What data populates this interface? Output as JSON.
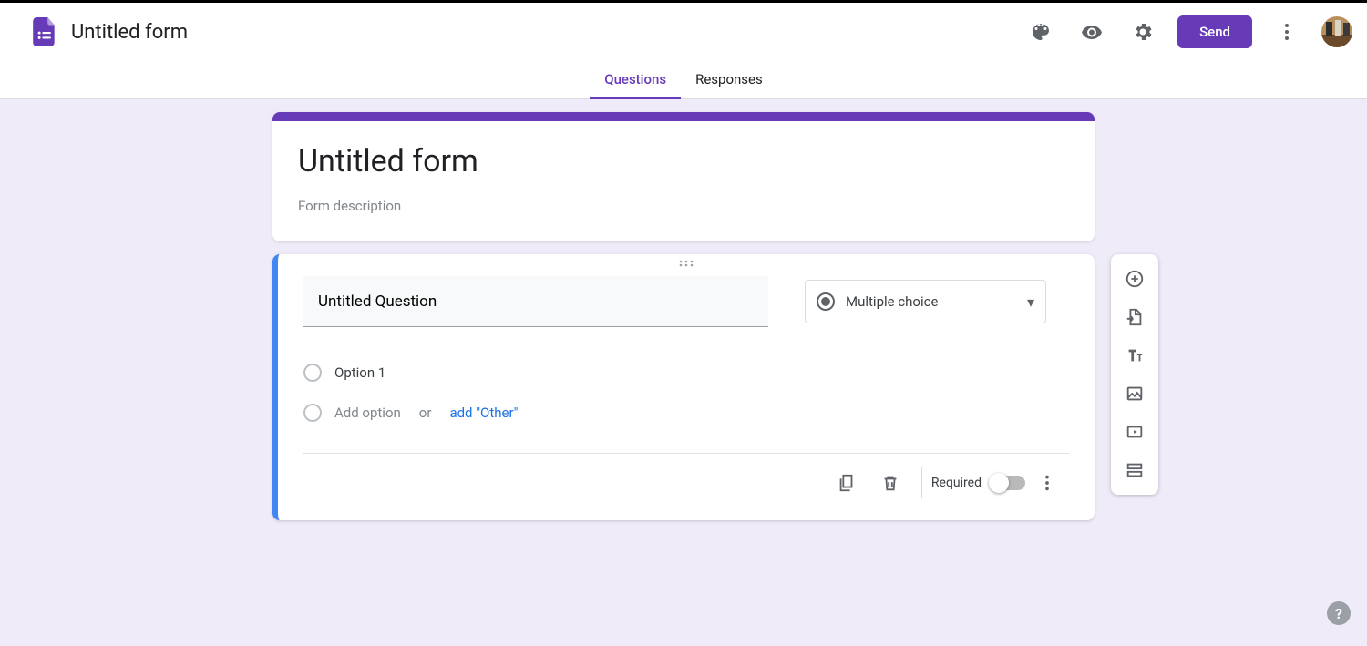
{
  "brand": {
    "color": "#673ab7"
  },
  "header": {
    "doc_title": "Untitled form",
    "send_label": "Send"
  },
  "tabs": {
    "questions": "Questions",
    "responses": "Responses"
  },
  "form": {
    "title": "Untitled form",
    "description_placeholder": "Form description"
  },
  "question": {
    "title": "Untitled Question",
    "type_label": "Multiple choice",
    "options": [
      "Option 1"
    ],
    "add_option_label": "Add option",
    "or_label": "or",
    "add_other_label": "add \"Other\"",
    "required_label": "Required",
    "required_value": false
  },
  "colors": {
    "accent": "#673ab7",
    "link": "#1a73e8",
    "selection": "#4285f4",
    "canvas_bg": "#f0ebf8"
  }
}
